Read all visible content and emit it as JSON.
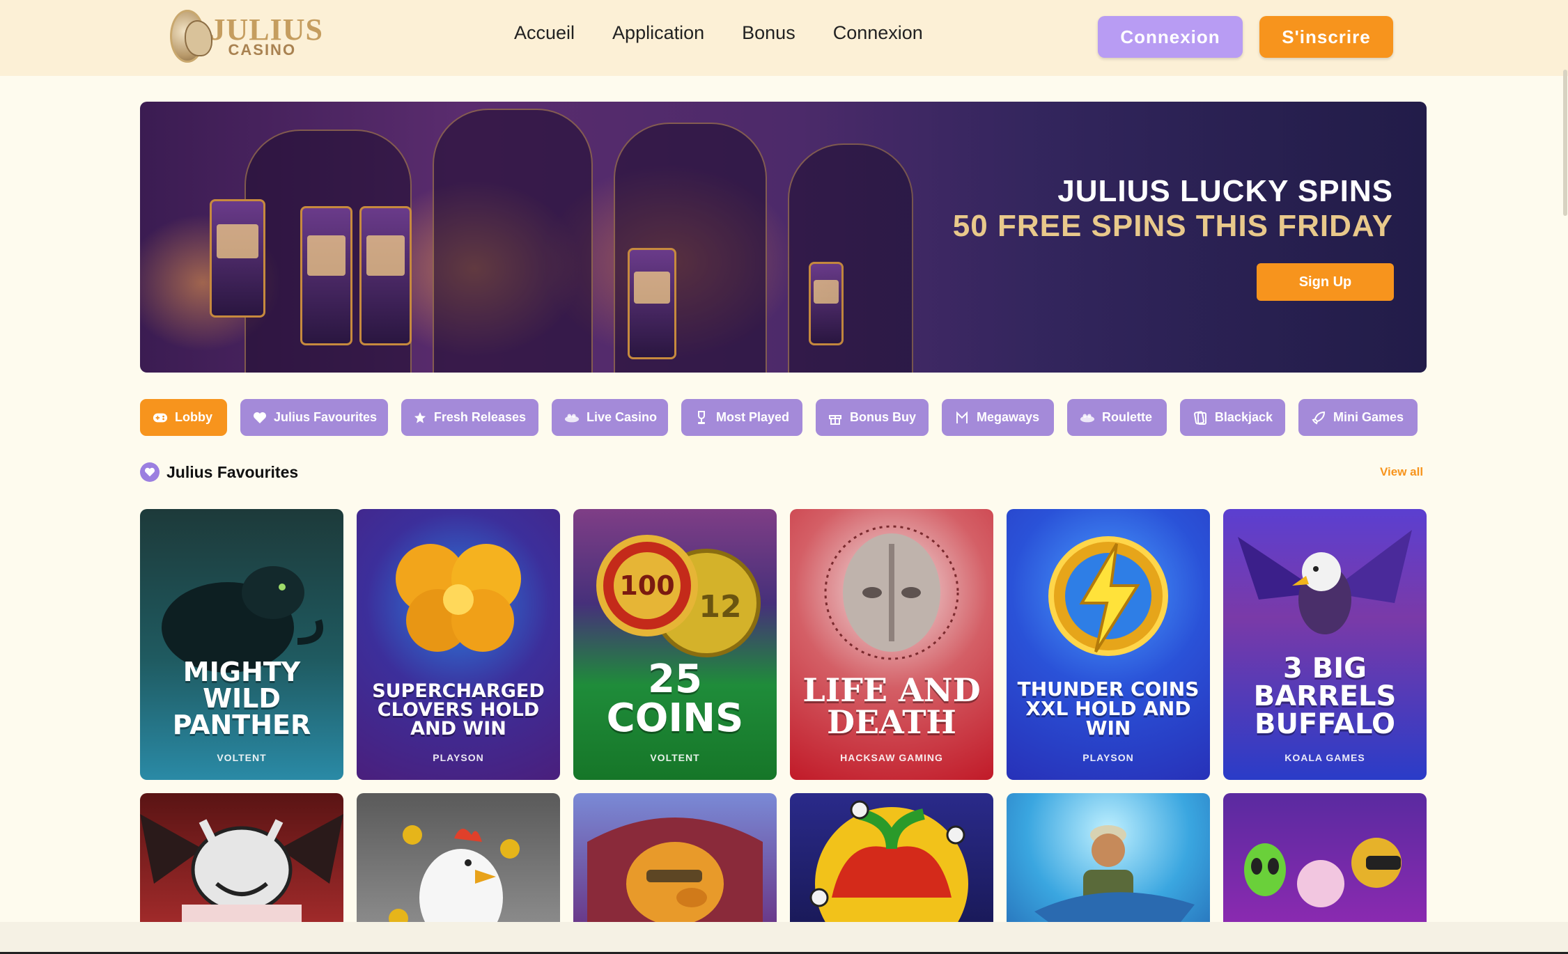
{
  "header": {
    "logo_word1": "JULIUS",
    "logo_word2": "CASINO",
    "nav": [
      "Accueil",
      "Application",
      "Bonus",
      "Connexion"
    ],
    "login_label": "Connexion",
    "signup_label": "S'inscrire"
  },
  "banner": {
    "title_line1": "JULIUS LUCKY SPINS",
    "title_line2": "50 FREE SPINS THIS FRIDAY",
    "cta_label": "Sign Up"
  },
  "categories": [
    {
      "label": "Lobby",
      "icon": "gamepad-icon",
      "active": true
    },
    {
      "label": "Julius Favourites",
      "icon": "heart-icon"
    },
    {
      "label": "Fresh Releases",
      "icon": "star-icon"
    },
    {
      "label": "Live Casino",
      "icon": "live-casino-icon"
    },
    {
      "label": "Most Played",
      "icon": "trophy-icon"
    },
    {
      "label": "Bonus Buy",
      "icon": "gift-icon"
    },
    {
      "label": "Megaways",
      "icon": "megaways-icon"
    },
    {
      "label": "Roulette",
      "icon": "roulette-icon"
    },
    {
      "label": "Blackjack",
      "icon": "cards-icon"
    },
    {
      "label": "Mini Games",
      "icon": "rocket-icon"
    }
  ],
  "section": {
    "title": "Julius Favourites",
    "view_all": "View all"
  },
  "games": [
    {
      "name": "MIGHTY WILD PANTHER",
      "provider": "VOLTENT"
    },
    {
      "name": "SUPERCHARGED CLOVERS HOLD AND WIN",
      "provider": "PLAYSON"
    },
    {
      "name": "25 COINS",
      "provider": "VOLTENT"
    },
    {
      "name": "LIFE AND DEATH",
      "provider": "HACKSAW GAMING"
    },
    {
      "name": "THUNDER COINS XXL HOLD AND WIN",
      "provider": "PLAYSON"
    },
    {
      "name": "3 BIG BARRELS BUFFALO",
      "provider": "KOALA GAMES"
    }
  ],
  "coin_labels": {
    "big": "100",
    "small": "12"
  },
  "colors": {
    "header_bg": "#fcf0d6",
    "accent_orange": "#f7941d",
    "accent_purple": "#a48ad9",
    "page_bg": "#fefbee"
  }
}
